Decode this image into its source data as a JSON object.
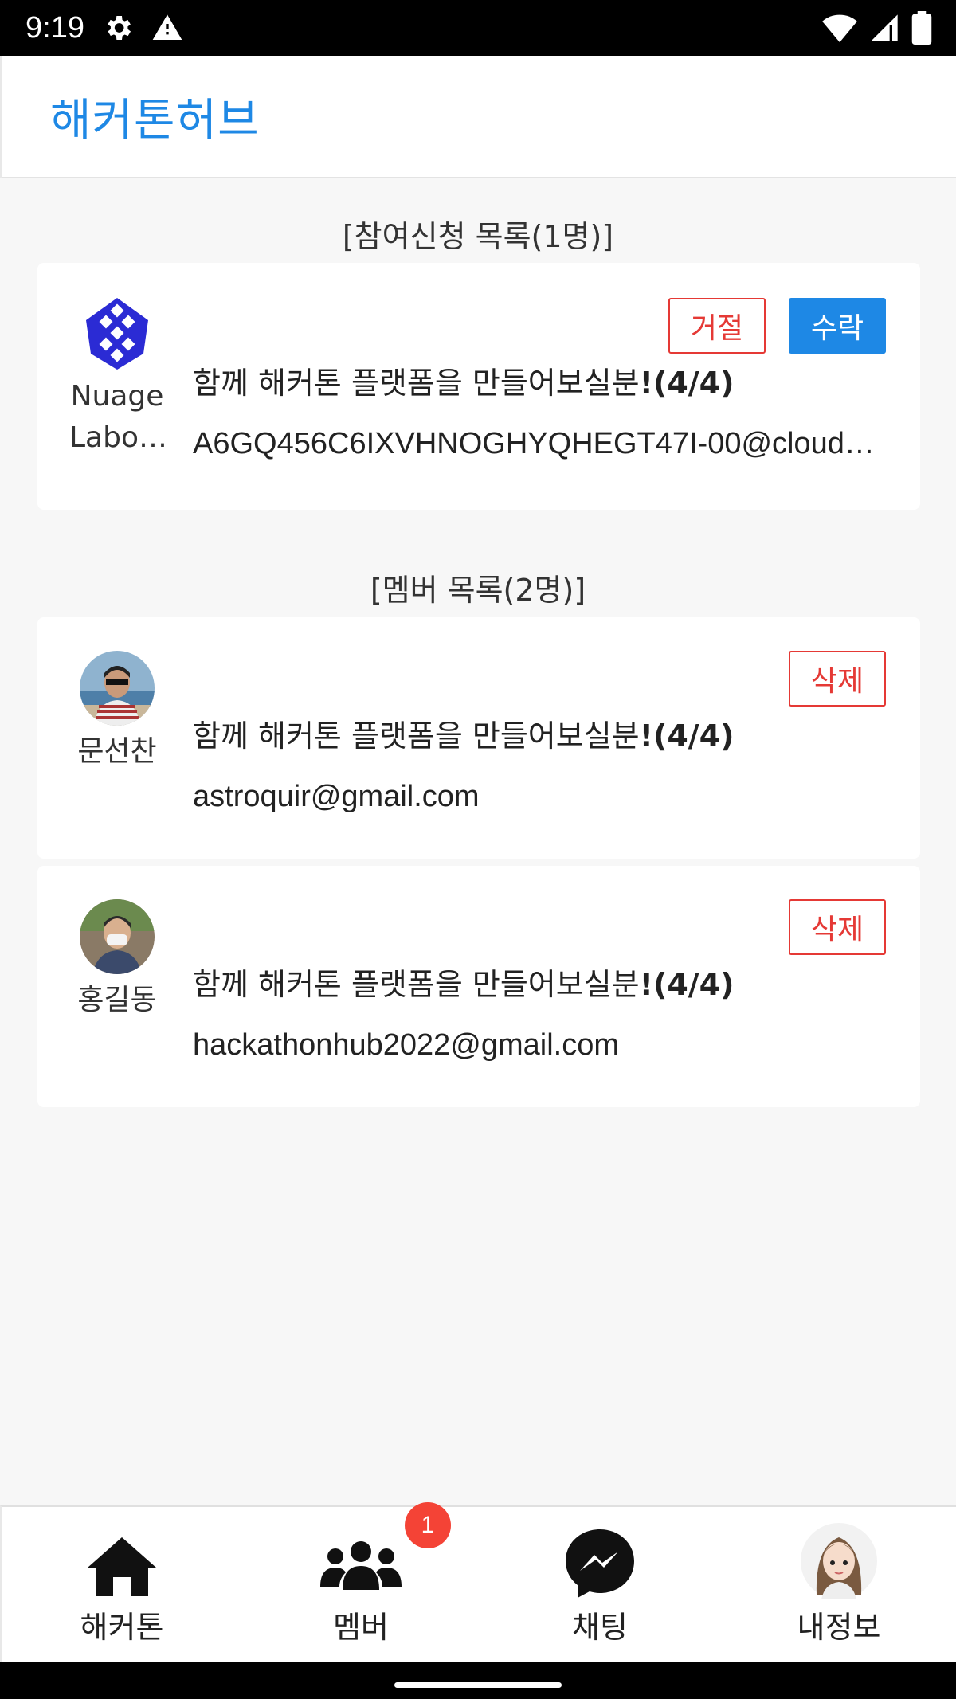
{
  "status_bar": {
    "time": "9:19"
  },
  "header": {
    "title": "해커톤허브"
  },
  "requests": {
    "section_title": "[참여신청 목록(1명)]",
    "items": [
      {
        "name": "Nuage Labo…",
        "name_line1": "Nuage",
        "name_line2": "Labo…",
        "title": "함께 해커톤 플랫폼을 만들어보실분",
        "count": "!(4/4)",
        "email": "A6GQ456C6IXVHNOGHYQHEGT47I-00@cloud…",
        "reject_label": "거절",
        "accept_label": "수락"
      }
    ]
  },
  "members": {
    "section_title": "[멤버 목록(2명)]",
    "items": [
      {
        "name": "문선찬",
        "title": "함께 해커톤 플랫폼을 만들어보실분",
        "count": "!(4/4)",
        "email": "astroquir@gmail.com",
        "delete_label": "삭제"
      },
      {
        "name": "홍길동",
        "title": "함께 해커톤 플랫폼을 만들어보실분",
        "count": "!(4/4)",
        "email": "hackathonhub2022@gmail.com",
        "delete_label": "삭제"
      }
    ]
  },
  "bottom_nav": {
    "items": [
      {
        "label": "해커톤",
        "icon": "home-icon"
      },
      {
        "label": "멤버",
        "icon": "users-icon",
        "badge": "1"
      },
      {
        "label": "채팅",
        "icon": "messenger-icon"
      },
      {
        "label": "내정보",
        "icon": "profile-avatar"
      }
    ]
  },
  "colors": {
    "accent": "#1e88e5",
    "danger": "#e53935",
    "badge": "#f44336"
  }
}
